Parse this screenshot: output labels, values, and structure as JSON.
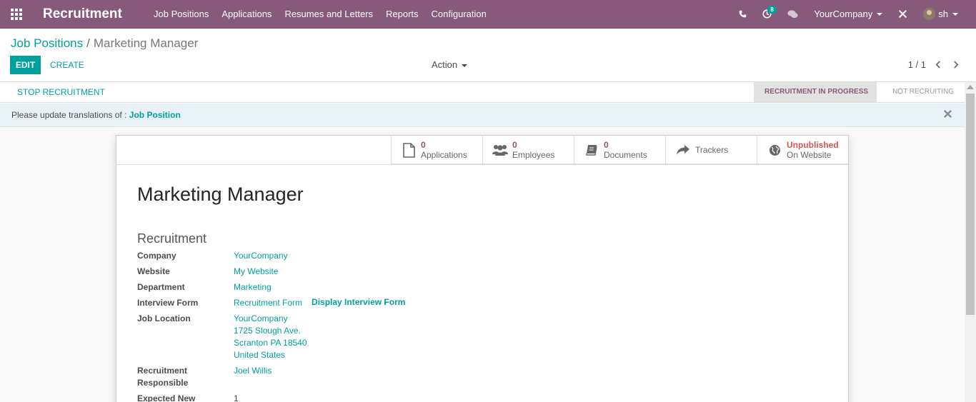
{
  "navbar": {
    "brand": "Recruitment",
    "menu": [
      "Job Positions",
      "Applications",
      "Resumes and Letters",
      "Reports",
      "Configuration"
    ],
    "activity_count": "8",
    "company": "YourCompany",
    "user": "sh"
  },
  "breadcrumb": {
    "parent": "Job Positions",
    "separator": "/",
    "current": "Marketing Manager"
  },
  "toolbar": {
    "edit": "EDIT",
    "create": "CREATE",
    "action": "Action"
  },
  "pager": {
    "value": "1 / 1"
  },
  "statusbar": {
    "stop_button": "STOP RECRUITMENT",
    "stages": [
      {
        "label": "RECRUITMENT IN PROGRESS",
        "active": true
      },
      {
        "label": "NOT RECRUITING",
        "active": false
      }
    ]
  },
  "alert": {
    "text": "Please update translations of : ",
    "link": "Job Position"
  },
  "smart_buttons": {
    "applications": {
      "count": "0",
      "label": "Applications"
    },
    "employees": {
      "count": "0",
      "label": "Employees"
    },
    "documents": {
      "count": "0",
      "label": "Documents"
    },
    "trackers": {
      "label": "Trackers"
    },
    "website": {
      "status": "Unpublished",
      "label": "On Website"
    }
  },
  "form": {
    "title": "Marketing Manager",
    "group_title": "Recruitment",
    "company_label": "Company",
    "company": "YourCompany",
    "website_label": "Website",
    "website": "My Website",
    "department_label": "Department",
    "department": "Marketing",
    "interview_label": "Interview Form",
    "interview": "Recruitment Form",
    "interview_link": "Display Interview Form",
    "location_label": "Job Location",
    "location_lines": [
      "YourCompany",
      "1725 Slough Ave.",
      "Scranton PA 18540",
      "United States"
    ],
    "responsible_label_1": "Recruitment",
    "responsible_label_2": "Responsible",
    "responsible": "Joel Willis",
    "expected_label": "Expected New",
    "expected": "1"
  },
  "colors": {
    "brand": "#875a7b",
    "accent": "#00a09d",
    "danger": "#d9534f"
  }
}
